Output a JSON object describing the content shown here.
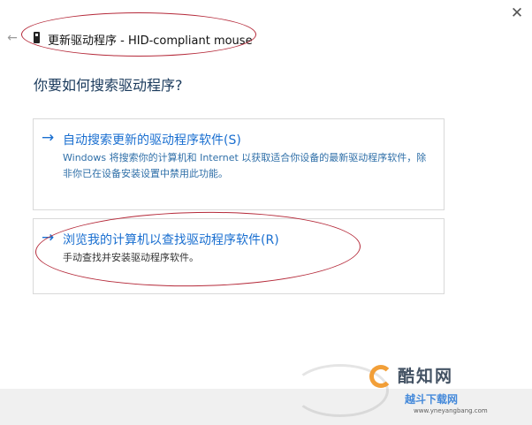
{
  "window": {
    "title": "更新驱动程序 - HID-compliant mouse",
    "close_glyph": "✕",
    "back_glyph": "←"
  },
  "heading": "你要如何搜索驱动程序?",
  "options": [
    {
      "arrow": "→",
      "title": "自动搜索更新的驱动程序软件(S)",
      "description": "Windows 将搜索你的计算机和 Internet 以获取适合你设备的最新驱动程序软件，除非你已在设备安装设置中禁用此功能。"
    },
    {
      "arrow": "→",
      "title": "浏览我的计算机以查找驱动程序软件(R)",
      "description": "手动查找并安装驱动程序软件。"
    }
  ],
  "watermark": {
    "main": "酷知网",
    "sub": "越斗下载网",
    "url": "www.yneyangbang.com"
  },
  "colors": {
    "link_blue": "#1a6fd0",
    "annotation_red": "#b52a3a",
    "watermark_orange": "#f29a2e"
  },
  "icons": {
    "close": "close-icon",
    "back": "back-arrow-icon",
    "device": "usb-device-icon",
    "option_arrow": "right-arrow-icon"
  }
}
